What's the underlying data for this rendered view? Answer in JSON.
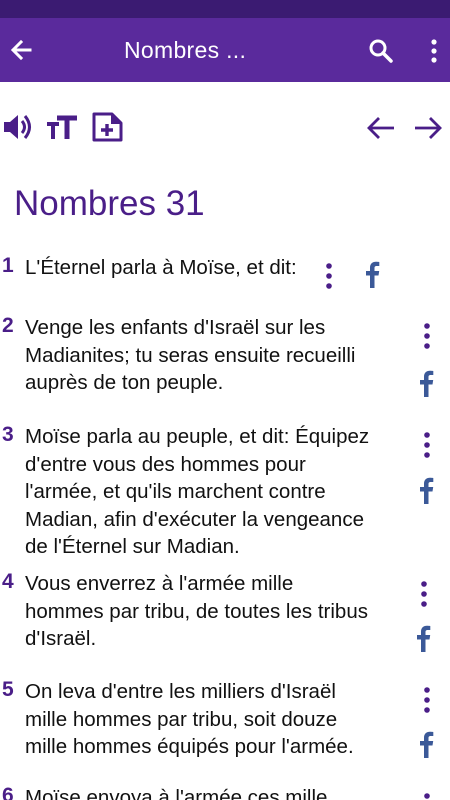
{
  "app_bar": {
    "title": "Nombres ...",
    "back_icon": "arrow-left-icon",
    "search_icon": "search-icon",
    "more_icon": "more-vertical-icon"
  },
  "toolbar": {
    "audio_icon": "speaker-icon",
    "text_size_icon": "text-size-icon",
    "add_note_icon": "note-add-icon",
    "previous_icon": "arrow-left-icon",
    "next_icon": "arrow-right-icon"
  },
  "chapter": {
    "title": "Nombres 31"
  },
  "verses": [
    {
      "number": "1",
      "lines": [
        "L'Éternel parla à Moïse, et dit:"
      ]
    },
    {
      "number": "2",
      "lines": [
        "Venge les enfants d'Israël sur les",
        "Madianites; tu seras ensuite recueilli",
        "auprès de ton peuple."
      ]
    },
    {
      "number": "3",
      "lines": [
        "Moïse parla au peuple, et dit: Équipez",
        "d'entre vous des hommes pour",
        "l'armée, et qu'ils marchent contre",
        "Madian, afin d'exécuter la vengeance",
        "de l'Éternel sur Madian."
      ]
    },
    {
      "number": "4",
      "lines": [
        "Vous enverrez à l'armée mille",
        "hommes par tribu, de toutes les tribus",
        "d'Israël."
      ]
    },
    {
      "number": "5",
      "lines": [
        "On leva d'entre les milliers d'Israël",
        "mille hommes par tribu, soit douze",
        "mille hommes équipés pour l'armée."
      ]
    },
    {
      "number": "6",
      "lines": [
        "Moïse envoya à l'armée ces mille"
      ]
    }
  ],
  "colors": {
    "status_bar": "#3b1b72",
    "app_bar": "#5a2a9c",
    "accent": "#4a1e88",
    "facebook": "#3b5998"
  }
}
